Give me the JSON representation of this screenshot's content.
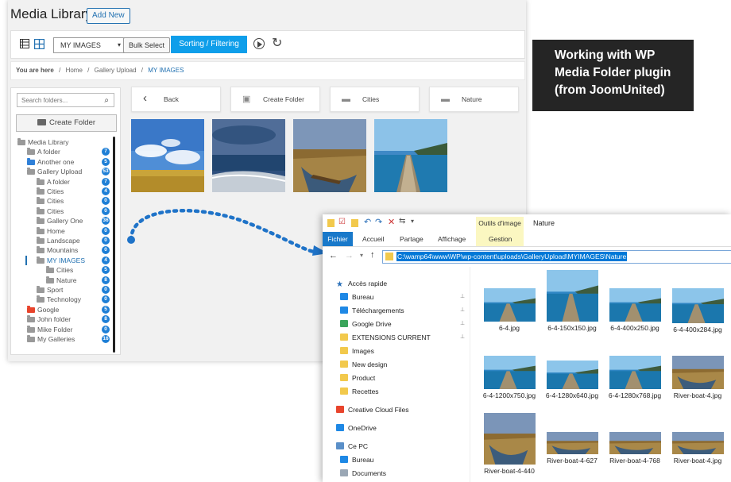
{
  "wp_panel": {
    "title": "Media Library",
    "add_new": "Add New",
    "folder_select": "MY IMAGES",
    "bulk_select": "Bulk Select",
    "sorting_filtering": "Sorting / Filtering",
    "breadcrumb": {
      "prefix": "You are here",
      "items": [
        "Home",
        "Gallery Upload",
        "MY IMAGES"
      ],
      "separator": "/"
    },
    "search_placeholder": "Search folders...",
    "create_folder": "Create Folder",
    "tree": [
      {
        "label": "Media Library",
        "count": "",
        "color": "#999999",
        "depth": 0
      },
      {
        "label": "A folder",
        "count": "7",
        "color": "#999999",
        "depth": 1
      },
      {
        "label": "Another one",
        "count": "5",
        "color": "#2f80d8",
        "depth": 1
      },
      {
        "label": "Gallery Upload",
        "count": "53",
        "color": "#999999",
        "depth": 1
      },
      {
        "label": "A folder",
        "count": "7",
        "color": "#999999",
        "depth": 2
      },
      {
        "label": "Cities",
        "count": "4",
        "color": "#999999",
        "depth": 2
      },
      {
        "label": "Cities",
        "count": "0",
        "color": "#999999",
        "depth": 2
      },
      {
        "label": "Cities",
        "count": "0",
        "color": "#999999",
        "depth": 2
      },
      {
        "label": "Gallery One",
        "count": "36",
        "color": "#999999",
        "depth": 2
      },
      {
        "label": "Home",
        "count": "0",
        "color": "#999999",
        "depth": 2
      },
      {
        "label": "Landscape",
        "count": "0",
        "color": "#999999",
        "depth": 2
      },
      {
        "label": "Mountains",
        "count": "0",
        "color": "#999999",
        "depth": 2
      },
      {
        "label": "MY IMAGES",
        "count": "4",
        "color": "#999999",
        "depth": 2
      },
      {
        "label": "Cities",
        "count": "5",
        "color": "#999999",
        "depth": 3
      },
      {
        "label": "Nature",
        "count": "8",
        "color": "#999999",
        "depth": 3
      },
      {
        "label": "Sport",
        "count": "0",
        "color": "#999999",
        "depth": 2
      },
      {
        "label": "Technology",
        "count": "0",
        "color": "#999999",
        "depth": 2
      },
      {
        "label": "Google",
        "count": "5",
        "color": "#e8442c",
        "depth": 1
      },
      {
        "label": "John folder",
        "count": "8",
        "color": "#999999",
        "depth": 1
      },
      {
        "label": "Mike Folder",
        "count": "0",
        "color": "#999999",
        "depth": 1
      },
      {
        "label": "My Galleries",
        "count": "16",
        "color": "#999999",
        "depth": 1
      }
    ],
    "nav_cards": [
      {
        "label": "Back",
        "icon": "chevron-left-icon"
      },
      {
        "label": "Create Folder",
        "icon": "folder-plus-icon"
      },
      {
        "label": "Cities",
        "icon": "folder-icon"
      },
      {
        "label": "Nature",
        "icon": "folder-icon"
      }
    ]
  },
  "promo": {
    "line1": "Working with WP",
    "line2": "Media Folder plugin",
    "line3": "(from JoomUnited)"
  },
  "explorer": {
    "title": "Nature",
    "contextual_tab": "Outils d'image",
    "contextual_sub": "Gestion",
    "tabs": [
      "Fichier",
      "Accueil",
      "Partage",
      "Affichage"
    ],
    "address": "C:\\wamp64\\www\\WP\\wp-content\\uploads\\GalleryUpload\\MYIMAGES\\Nature",
    "nav_items": [
      {
        "label": "Accès rapide",
        "icon": "star-icon",
        "pinned": false
      },
      {
        "label": "Bureau",
        "icon": "desktop-icon",
        "pinned": true
      },
      {
        "label": "Téléchargements",
        "icon": "download-icon",
        "pinned": true
      },
      {
        "label": "Google Drive",
        "icon": "google-drive-icon",
        "pinned": true
      },
      {
        "label": "EXTENSIONS CURRENT",
        "icon": "folder-icon",
        "pinned": true
      },
      {
        "label": "Images",
        "icon": "folder-icon",
        "pinned": false
      },
      {
        "label": "New design",
        "icon": "folder-icon",
        "pinned": false
      },
      {
        "label": "Product",
        "icon": "folder-icon",
        "pinned": false
      },
      {
        "label": "Recettes",
        "icon": "folder-icon",
        "pinned": false
      },
      {
        "label": "Creative Cloud Files",
        "icon": "creative-cloud-icon",
        "pinned": false
      },
      {
        "label": "OneDrive",
        "icon": "onedrive-icon",
        "pinned": false
      },
      {
        "label": "Ce PC",
        "icon": "pc-icon",
        "pinned": false
      },
      {
        "label": "Bureau",
        "icon": "desktop-icon",
        "pinned": false
      },
      {
        "label": "Documents",
        "icon": "documents-icon",
        "pinned": false
      }
    ],
    "files": [
      {
        "name": "6-4.jpg",
        "kind": "pier"
      },
      {
        "name": "6-4-150x150.jpg",
        "kind": "pier"
      },
      {
        "name": "6-4-400x250.jpg",
        "kind": "pier"
      },
      {
        "name": "6-4-400x284.jpg",
        "kind": "pier"
      },
      {
        "name": "6-4-1200x750.jpg",
        "kind": "pier"
      },
      {
        "name": "6-4-1280x640.jpg",
        "kind": "pier"
      },
      {
        "name": "6-4-1280x768.jpg",
        "kind": "pier"
      },
      {
        "name": "River-boat-4.jpg",
        "kind": "boat"
      },
      {
        "name": "River-boat-4-440",
        "kind": "boat"
      },
      {
        "name": "River-boat-4-627",
        "kind": "boat"
      },
      {
        "name": "River-boat-4-768",
        "kind": "boat"
      },
      {
        "name": "River-boat-4.jpg",
        "kind": "boat"
      }
    ]
  }
}
